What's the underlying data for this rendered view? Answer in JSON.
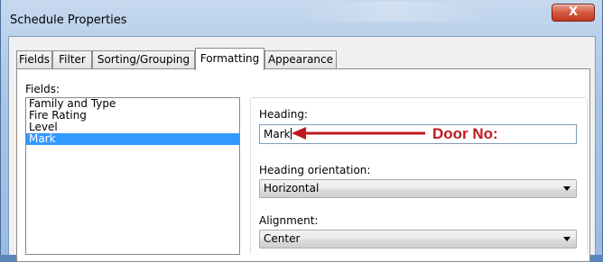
{
  "window": {
    "title": "Schedule Properties",
    "close_glyph": "X"
  },
  "tabs": [
    {
      "label": "Fields"
    },
    {
      "label": "Filter"
    },
    {
      "label": "Sorting/Grouping"
    },
    {
      "label": "Formatting",
      "active": true
    },
    {
      "label": "Appearance"
    }
  ],
  "fields": {
    "label": "Fields:",
    "items": [
      "Family and Type",
      "Fire Rating",
      "Level",
      "Mark"
    ],
    "selected": "Mark"
  },
  "formatting": {
    "heading_label": "Heading:",
    "heading_value": "Mark",
    "orientation_label": "Heading orientation:",
    "orientation_value": "Horizontal",
    "alignment_label": "Alignment:",
    "alignment_value": "Center"
  },
  "annotation": {
    "text": "Door No:",
    "color": "#c0191d"
  }
}
